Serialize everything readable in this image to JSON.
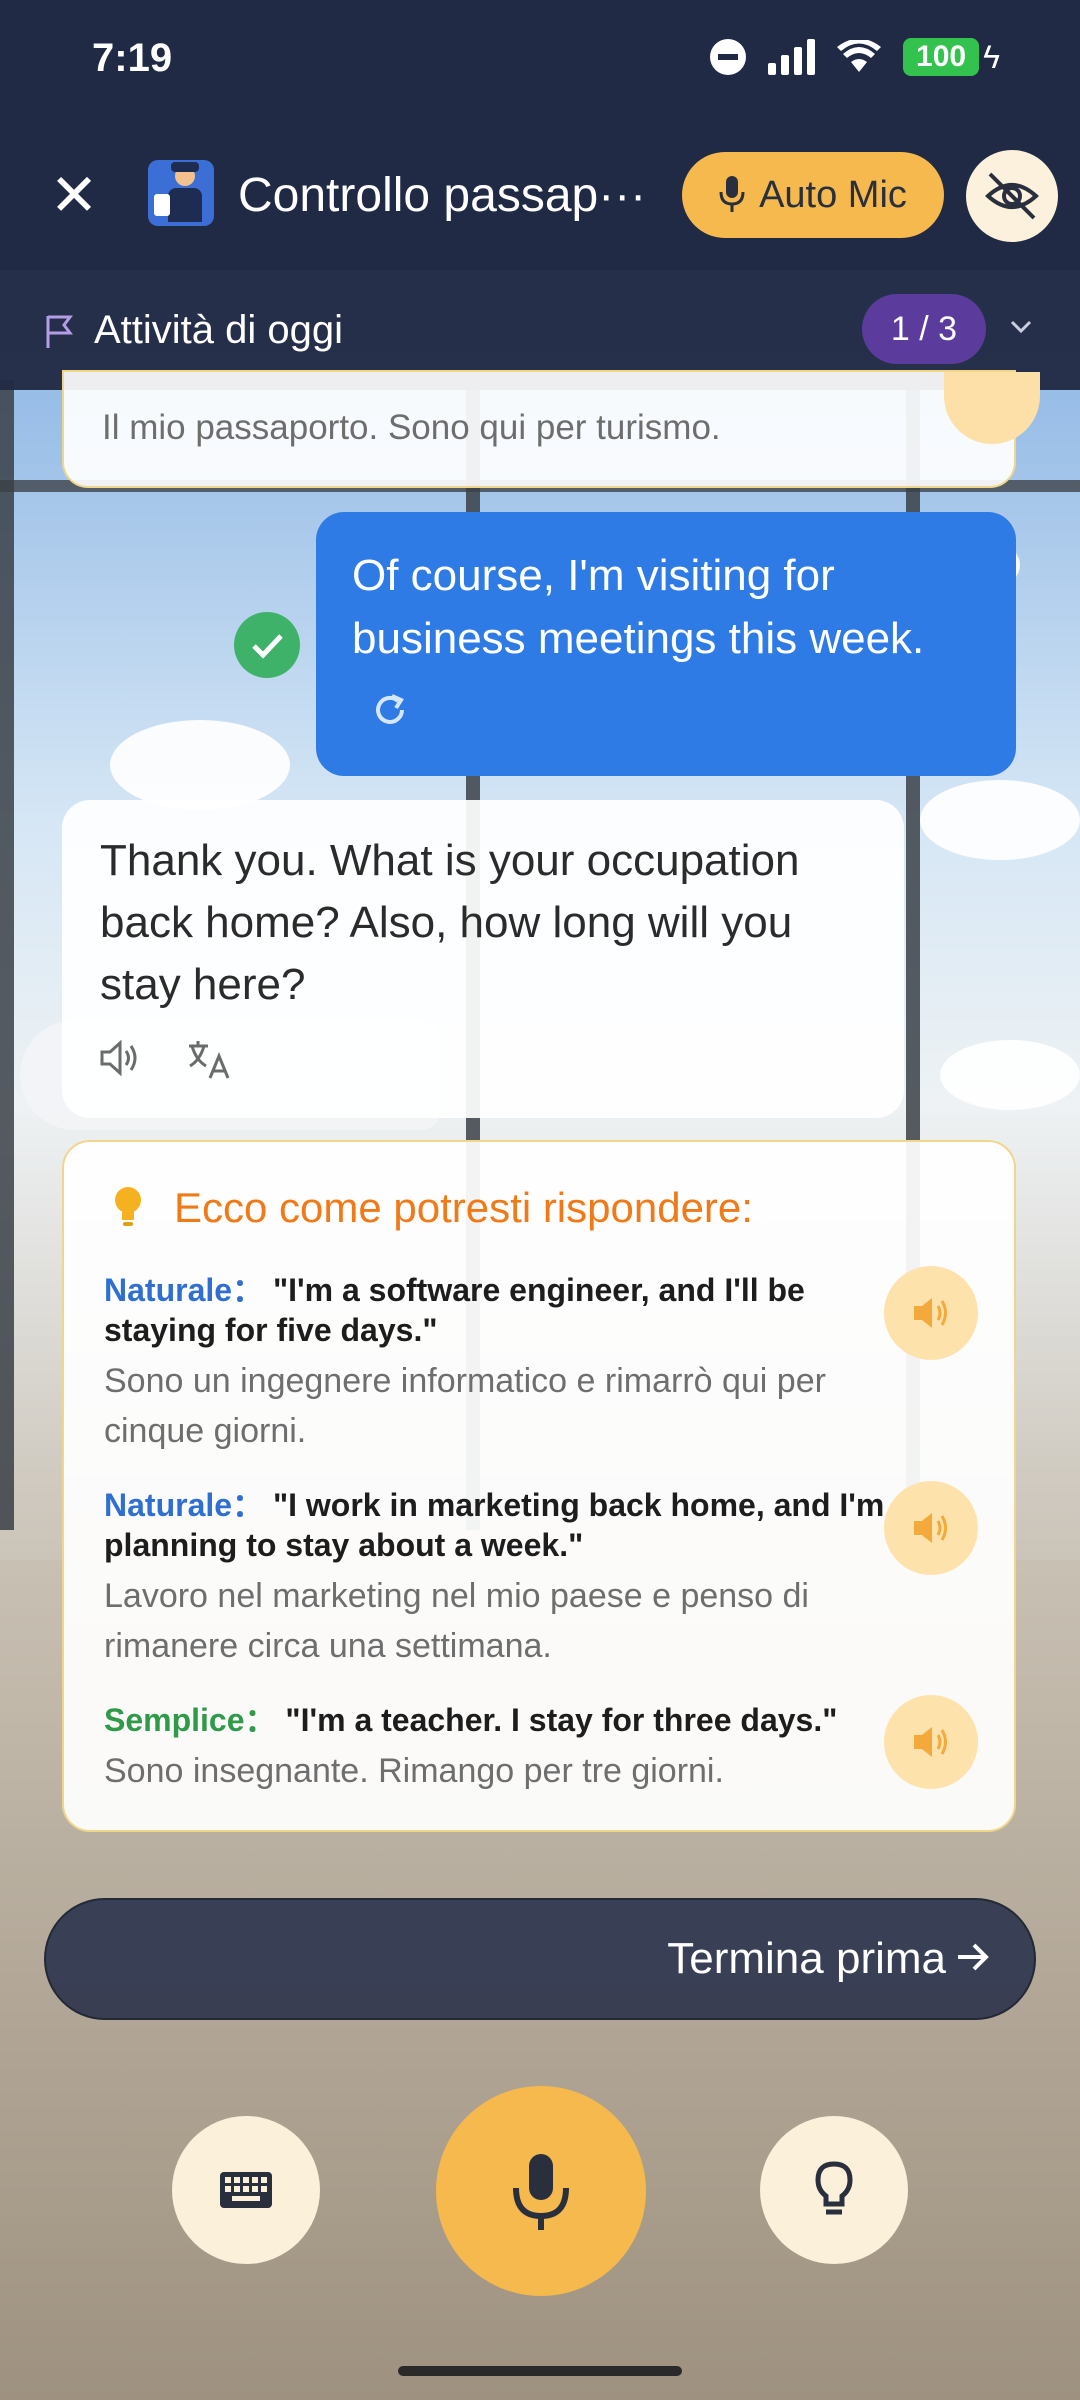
{
  "status_bar": {
    "time": "7:19",
    "battery": "100"
  },
  "header": {
    "title": "Controllo passap···",
    "auto_mic_label": "Auto Mic"
  },
  "tasks": {
    "label": "Attività di oggi",
    "count": "1 / 3"
  },
  "chat": {
    "previous_translation": "Il mio passaporto. Sono qui per turismo.",
    "user_message": "Of course, I'm visiting for business meetings this week.",
    "ai_message": "Thank you. What is your occupation back home? Also, how long will you stay here?"
  },
  "hints": {
    "title": "Ecco come potresti rispondere:",
    "options": [
      {
        "tag": "Naturale：",
        "tag_color": "#2f6fd0",
        "english": "\"I'm a software engineer, and I'll be staying for five days.\"",
        "italian": "Sono un ingegnere informatico e rimarrò qui per cinque giorni."
      },
      {
        "tag": "Naturale：",
        "tag_color": "#2f6fd0",
        "english": "\"I work in marketing back home, and I'm planning to stay about a week.\"",
        "italian": "Lavoro nel marketing nel mio paese e penso di rimanere circa una settimana."
      },
      {
        "tag": "Semplice：",
        "tag_color": "#2f9a4a",
        "english": "\"I'm a teacher. I stay for three days.\"",
        "italian": "Sono insegnante. Rimango per tre giorni."
      }
    ]
  },
  "finish_label": "Termina prima",
  "colors": {
    "accent": "#f5b94d",
    "user_bubble": "#2f7be6",
    "header": "#212a44",
    "hint_title": "#f07a18"
  }
}
